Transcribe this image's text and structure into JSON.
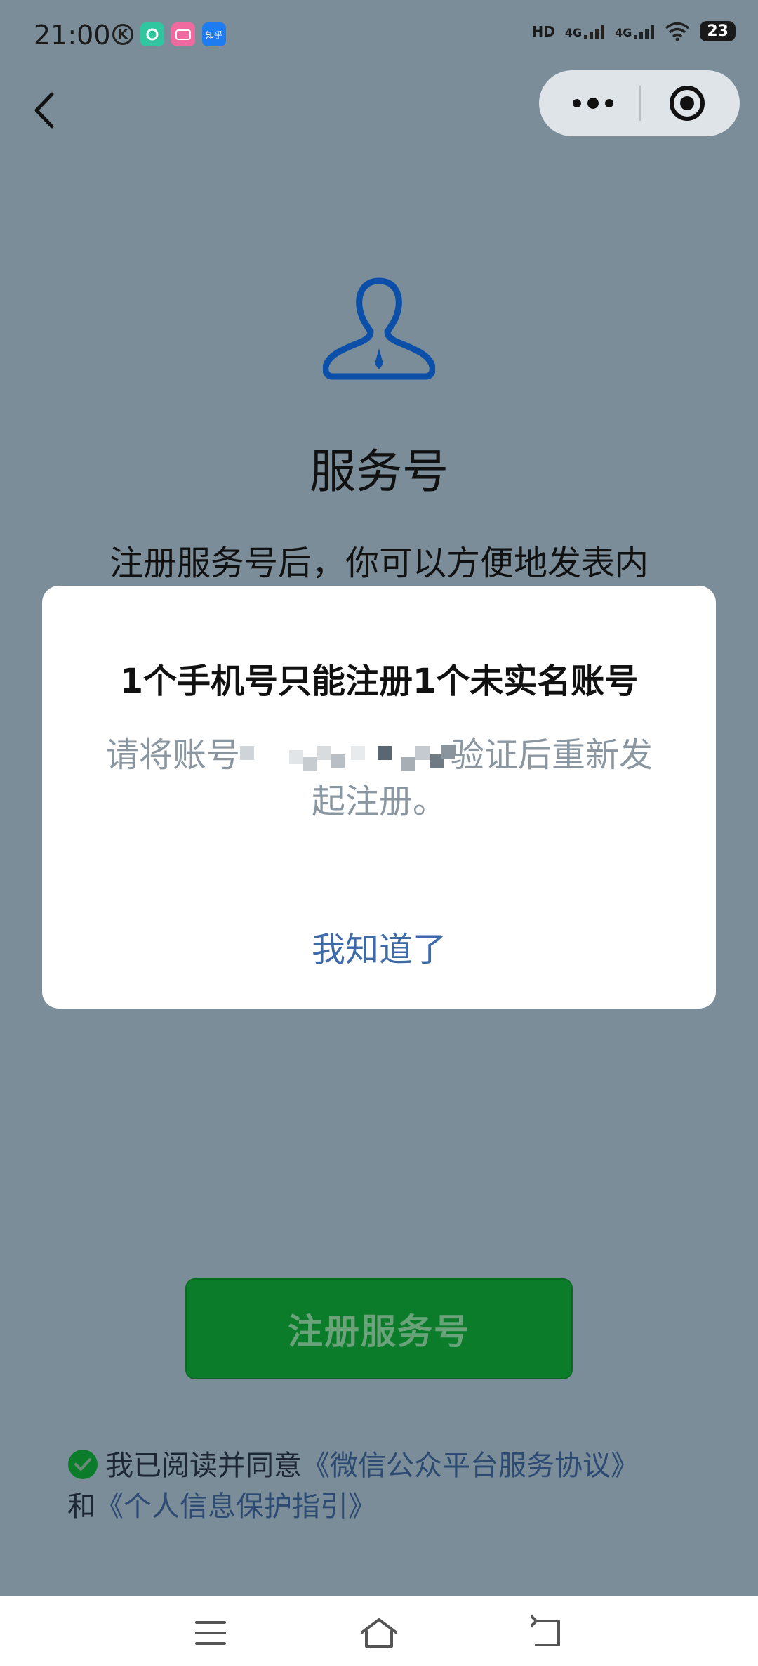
{
  "status_bar": {
    "time": "21:00",
    "app_icons": [
      "k-icon",
      "leaf-app-icon",
      "bilibili-icon",
      "zhihu-icon"
    ],
    "zhihu_label": "知乎",
    "signal_label_1": "4G",
    "signal_label_2": "4G",
    "hd_label": "HD",
    "battery": "23"
  },
  "header": {
    "back_icon": "chevron-left-icon",
    "more_icon": "more-dots-icon",
    "close_icon": "target-close-icon"
  },
  "main": {
    "icon": "service-account-person-icon",
    "title": "服务号",
    "intro": "注册服务号后，你可以方便地发表内"
  },
  "dialog": {
    "title": "1个手机号只能注册1个未实名账号",
    "body_prefix": "请将账号",
    "body_suffix": "验证后重新发",
    "body_line2": "起注册。",
    "ok_label": "我知道了"
  },
  "register_button": {
    "label": "注册服务号"
  },
  "agreement": {
    "prefix": "我已阅读并同意",
    "link1": "《微信公众平台服务协议》",
    "connector": "和",
    "link2": "《个人信息保护指引》"
  },
  "colors": {
    "overlay_bg": "#7a8d99",
    "primary_green": "#0b7d2a",
    "link_blue": "#3e6aa8",
    "icon_blue": "#0b4fa8"
  }
}
